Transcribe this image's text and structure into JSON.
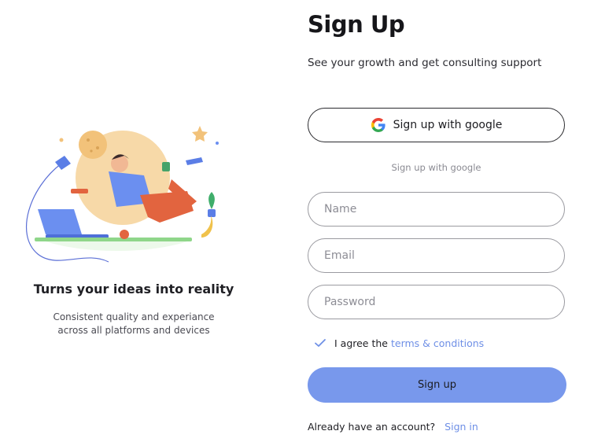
{
  "left": {
    "title": "Turns your ideas into reality",
    "subtitle": "Consistent quality and experiance across all platforms and devices"
  },
  "form": {
    "title": "Sign Up",
    "subtitle": "See your growth and get consulting support",
    "google_button": "Sign up with google",
    "divider": "Sign up with google",
    "fields": {
      "name_placeholder": "Name",
      "email_placeholder": "Email",
      "password_placeholder": "Password"
    },
    "agree_prefix": "I agree the",
    "terms_link": "terms & conditions",
    "agree_checked": true,
    "submit": "Sign up",
    "already": "Already have an account?",
    "signin": "Sign in"
  },
  "colors": {
    "accent": "#7898ec",
    "link": "#6e8fe6",
    "sun": "#f7d9a8"
  }
}
